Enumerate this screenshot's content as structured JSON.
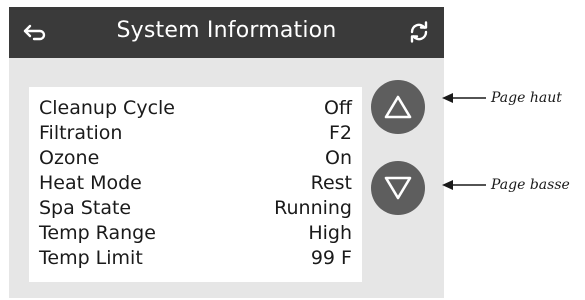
{
  "header": {
    "back_icon": "back-arrow-icon",
    "title": "System Information",
    "refresh_icon": "refresh-icon"
  },
  "info_rows": [
    {
      "label": "Cleanup Cycle",
      "value": "Off"
    },
    {
      "label": "Filtration",
      "value": "F2"
    },
    {
      "label": "Ozone",
      "value": "On"
    },
    {
      "label": "Heat Mode",
      "value": "Rest"
    },
    {
      "label": "Spa State",
      "value": "Running"
    },
    {
      "label": "Temp Range",
      "value": "High"
    },
    {
      "label": "Temp Limit",
      "value": "99 F"
    }
  ],
  "nav": {
    "up_icon": "triangle-up-icon",
    "down_icon": "triangle-down-icon"
  },
  "annotations": {
    "page_up": "Page haut",
    "page_down": "Page basse"
  },
  "colors": {
    "header_bg": "#3a3a3a",
    "device_bg": "#e6e6e6",
    "button_bg": "#5e5e5e"
  }
}
